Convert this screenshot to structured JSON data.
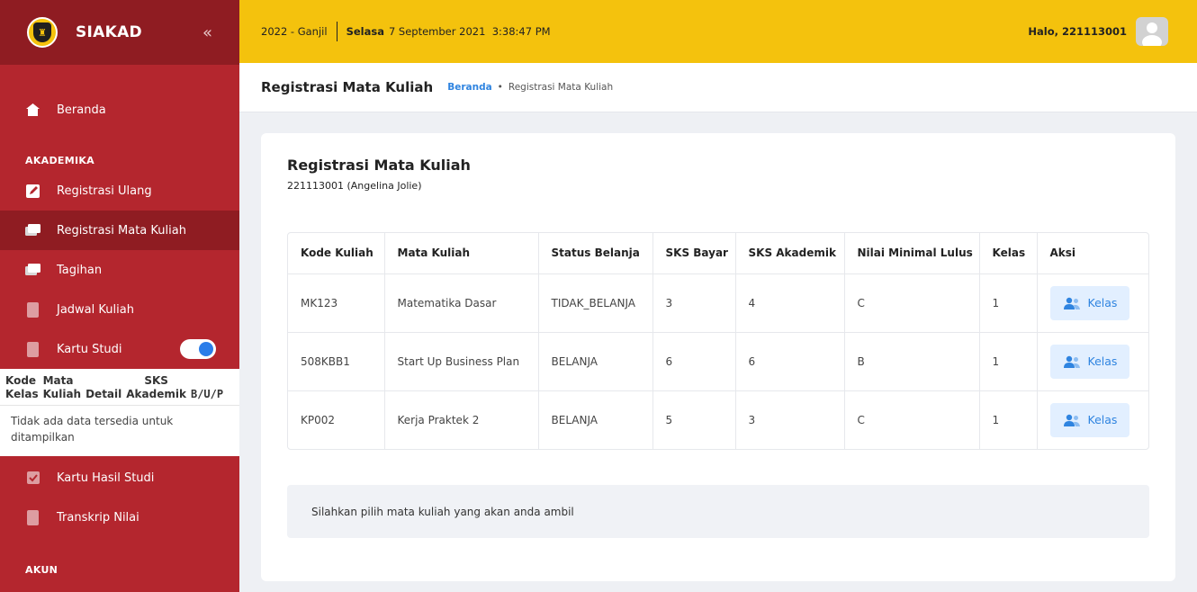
{
  "sidebar": {
    "brand": "SIAKAD",
    "home": "Beranda",
    "section_akademika": "AKADEMIKA",
    "items": [
      {
        "label": "Registrasi Ulang",
        "icon": "edit-icon"
      },
      {
        "label": "Registrasi Mata Kuliah",
        "icon": "card-icon",
        "active": true
      },
      {
        "label": "Tagihan",
        "icon": "card-icon"
      },
      {
        "label": "Jadwal Kuliah",
        "icon": "document-icon"
      },
      {
        "label": "Kartu Studi",
        "icon": "document-icon",
        "toggle": true
      }
    ],
    "mini_table": {
      "headers": [
        "Kode Kelas",
        "Mata Kuliah",
        "Detail",
        "SKS Akademik",
        "B/U/P"
      ],
      "col1_top": "Kode",
      "col1_bottom": "Kelas",
      "col2_top": "Mata",
      "col2_bottom": "Kuliah",
      "col3": "Detail",
      "col4_top": "SKS",
      "col4_bottom": "Akademik",
      "col5": "B/U/P",
      "empty": "Tidak ada data tersedia untuk ditampilkan"
    },
    "items_after": [
      {
        "label": "Kartu Hasil Studi",
        "icon": "check-document-icon"
      },
      {
        "label": "Transkrip Nilai",
        "icon": "document-icon"
      }
    ],
    "section_akun": "AKUN"
  },
  "topbar": {
    "semester": "2022 - Ganjil",
    "day": "Selasa",
    "datetime": "7 September 2021  3:38:47 PM",
    "greeting": "Halo, 221113001"
  },
  "subheader": {
    "title": "Registrasi Mata Kuliah",
    "crumb_home": "Beranda",
    "crumb_current": "Registrasi Mata Kuliah"
  },
  "card": {
    "title": "Registrasi Mata Kuliah",
    "subtitle": "221113001 (Angelina Jolie)",
    "columns": [
      "Kode Kuliah",
      "Mata Kuliah",
      "Status Belanja",
      "SKS Bayar",
      "SKS Akademik",
      "Nilai Minimal Lulus",
      "Kelas",
      "Aksi"
    ],
    "rows": [
      {
        "kode": "MK123",
        "mata": "Matematika Dasar",
        "status": "TIDAK_BELANJA",
        "sks_bayar": "3",
        "sks_akademik": "4",
        "nilai": "C",
        "kelas": "1",
        "aksi": "Kelas"
      },
      {
        "kode": "508KBB1",
        "mata": "Start Up Business Plan",
        "status": "BELANJA",
        "sks_bayar": "6",
        "sks_akademik": "6",
        "nilai": "B",
        "kelas": "1",
        "aksi": "Kelas"
      },
      {
        "kode": "KP002",
        "mata": "Kerja Praktek 2",
        "status": "BELANJA",
        "sks_bayar": "5",
        "sks_akademik": "3",
        "nilai": "C",
        "kelas": "1",
        "aksi": "Kelas"
      }
    ],
    "notice": "Silahkan pilih mata kuliah yang akan anda ambil"
  },
  "colors": {
    "sidebar": "#b4262e",
    "sidebar_dark": "#8f1c22",
    "topbar": "#f4c20d",
    "link": "#2f84e0"
  }
}
